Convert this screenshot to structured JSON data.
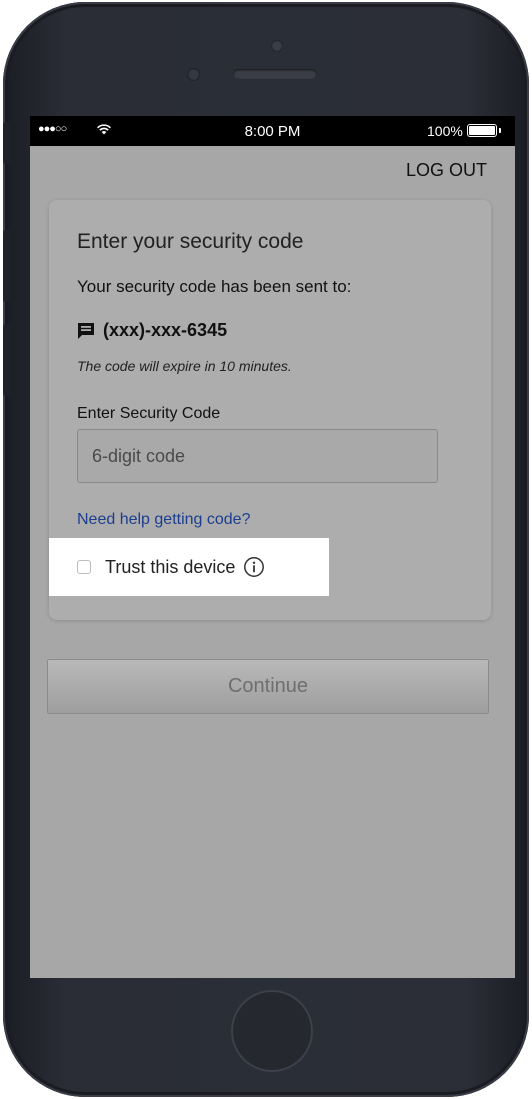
{
  "status_bar": {
    "signal": "●●●○○",
    "time": "8:00 PM",
    "battery": "100%"
  },
  "header": {
    "logout_label": "LOG OUT"
  },
  "card": {
    "title": "Enter your security code",
    "sent_to": "Your security code has been sent to:",
    "phone_number": "(xxx)-xxx-6345",
    "expire_note": "The code will expire in 10 minutes.",
    "code_label": "Enter Security Code",
    "code_placeholder": "6-digit code",
    "code_value": "",
    "help_link": "Need help getting code?",
    "trust_label": "Trust this device",
    "trust_checked": false
  },
  "continue_label": "Continue",
  "icons": {
    "wifi": "wifi-icon",
    "battery": "battery-icon",
    "message": "message-icon",
    "info": "info-icon"
  },
  "colors": {
    "overlay_gray": "#a7a7a7",
    "link_blue": "#1c3e8f",
    "highlight": "#ffffff"
  }
}
